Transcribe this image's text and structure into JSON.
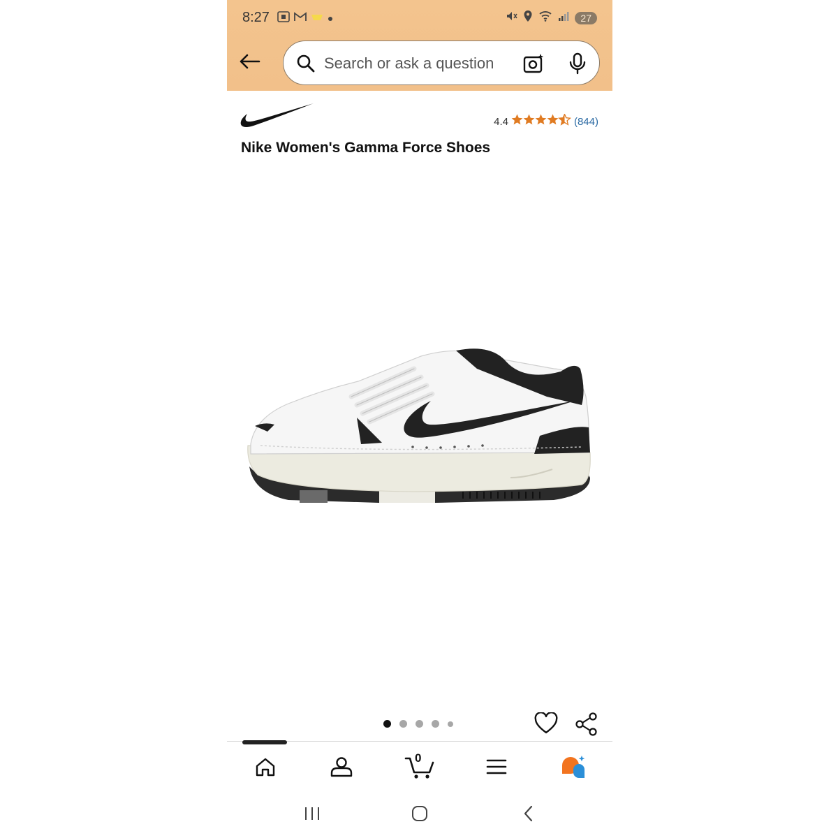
{
  "status_bar": {
    "time": "8:27",
    "battery": "27"
  },
  "search": {
    "placeholder": "Search or ask a question"
  },
  "product": {
    "brand": "Nike",
    "title": "Nike Women's Gamma Force Shoes",
    "rating_value": "4.4",
    "rating_stars": 4.5,
    "review_count": "(844)"
  },
  "carousel": {
    "total_images": 5,
    "active_index": 0
  },
  "bottom_nav": {
    "cart_count": "0"
  },
  "colors": {
    "header_bg": "#f2c08a",
    "star": "#e07b22",
    "link": "#2b6aa3"
  }
}
